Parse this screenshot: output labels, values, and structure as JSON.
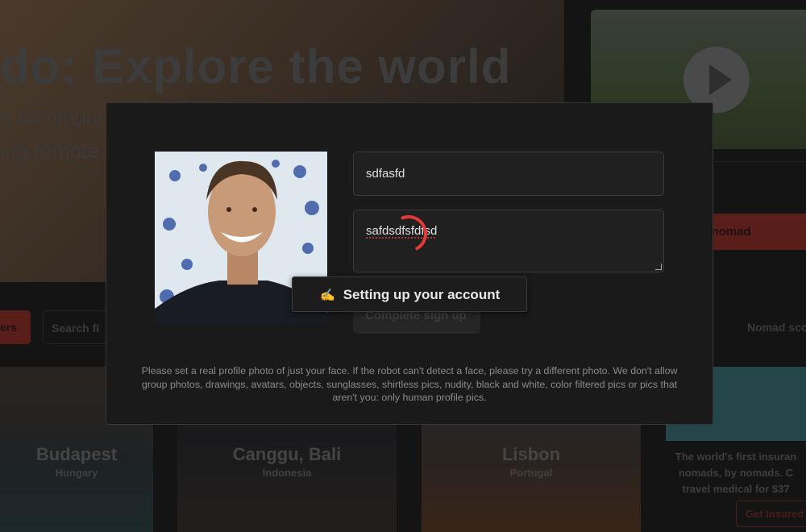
{
  "background": {
    "hero_title": "do: Explore the world",
    "hero_sub_1": "n communi",
    "hero_sub_2": "ing remote",
    "join_button": "e nomad",
    "filters_button": "ers",
    "search_placeholder": "Search fi",
    "sort_label": "Nomad sco",
    "cities": [
      {
        "name": "Budapest",
        "country": "Hungary"
      },
      {
        "name": "Canggu, Bali",
        "country": "Indonesia"
      },
      {
        "name": "Lisbon",
        "country": "Portugal"
      }
    ],
    "insurance": {
      "line1": "The world's first insuran",
      "line2": "nomads, by nomads. C",
      "line3": "travel medical for $37",
      "button": "Get Insured"
    }
  },
  "modal": {
    "name_value": "sdfasfd",
    "bio_value": "safdsdfsfdfsd",
    "submit_label": "Complete sign up",
    "toast": {
      "icon": "✍️",
      "text": "Setting up your account"
    },
    "note": "Please set a real profile photo of just your face. If the robot can't detect a face, please try a different photo. We don't allow group photos, drawings, avatars, objects, sunglasses, shirtless pics, nudity, black and white, color filtered pics or pics that aren't you: only human profile pics."
  },
  "colors": {
    "accent": "#e53935",
    "modal_bg": "#1a1a1a"
  }
}
